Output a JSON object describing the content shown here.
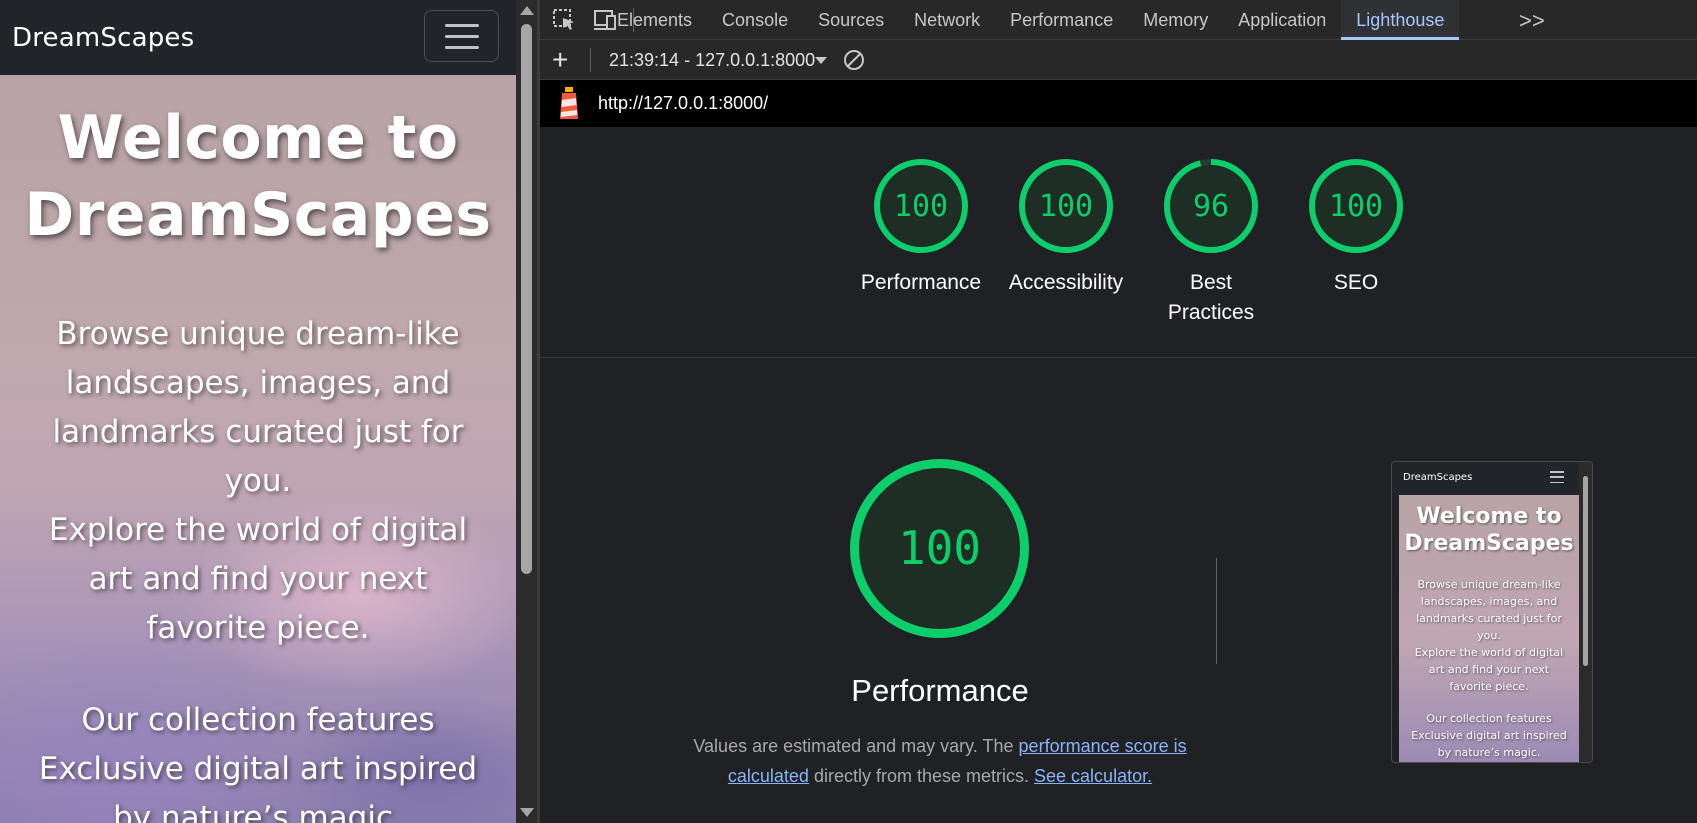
{
  "site": {
    "brand": "DreamScapes",
    "hero_title_1": "Welcome to",
    "hero_title_2": "DreamScapes",
    "paragraph_1_lines": [
      "Browse unique dream-like",
      "landscapes, images, and",
      "landmarks curated just for",
      "you.",
      "Explore the world of digital",
      "art and find your next",
      "favorite piece."
    ],
    "paragraph_2_lines": [
      "Our collection features",
      "Exclusive digital art inspired",
      "by nature’s magic."
    ]
  },
  "devtools": {
    "tabs": [
      "Elements",
      "Console",
      "Sources",
      "Network",
      "Performance",
      "Memory",
      "Application",
      "Lighthouse"
    ],
    "active_tab": "Lighthouse",
    "more_tabs": ">>",
    "add_button": "+",
    "report_selector": "21:39:14 - 127.0.0.1:8000",
    "url": "http://127.0.0.1:8000/"
  },
  "lighthouse": {
    "colors": {
      "pass": "#0cce6b",
      "gauge_fill": "#1e2e24"
    },
    "scores": [
      {
        "label": "Performance",
        "score": 100
      },
      {
        "label": "Accessibility",
        "score": 100
      },
      {
        "label": "Best Practices",
        "score": 96
      },
      {
        "label": "SEO",
        "score": 100
      }
    ],
    "performance": {
      "score": 100,
      "title": "Performance",
      "desc_prefix": "Values are estimated and may vary. The ",
      "desc_link": "performance score is calculated",
      "desc_mid": " directly from these metrics. ",
      "desc_link2": "See calculator."
    }
  }
}
